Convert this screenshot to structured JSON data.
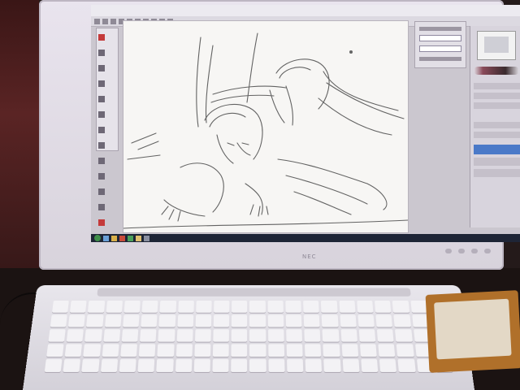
{
  "scene": {
    "description_colors": {
      "bezel": "#e9e4ee",
      "canvas": "#f7f6f4",
      "selected_layer": "#4a79c8",
      "taskbar": "#1e2536",
      "mousepad": "#b0702a"
    }
  },
  "app": {
    "menu_items": [
      "",
      "",
      "",
      "",
      "",
      "",
      "",
      "",
      ""
    ],
    "tool_icons": [
      "pen-icon",
      "eraser-icon",
      "brush-icon",
      "fill-icon",
      "select-icon",
      "move-icon",
      "zoom-icon",
      "hand-icon"
    ]
  },
  "taskbar": {
    "clock": ""
  },
  "monitor": {
    "brand": "NEC"
  }
}
